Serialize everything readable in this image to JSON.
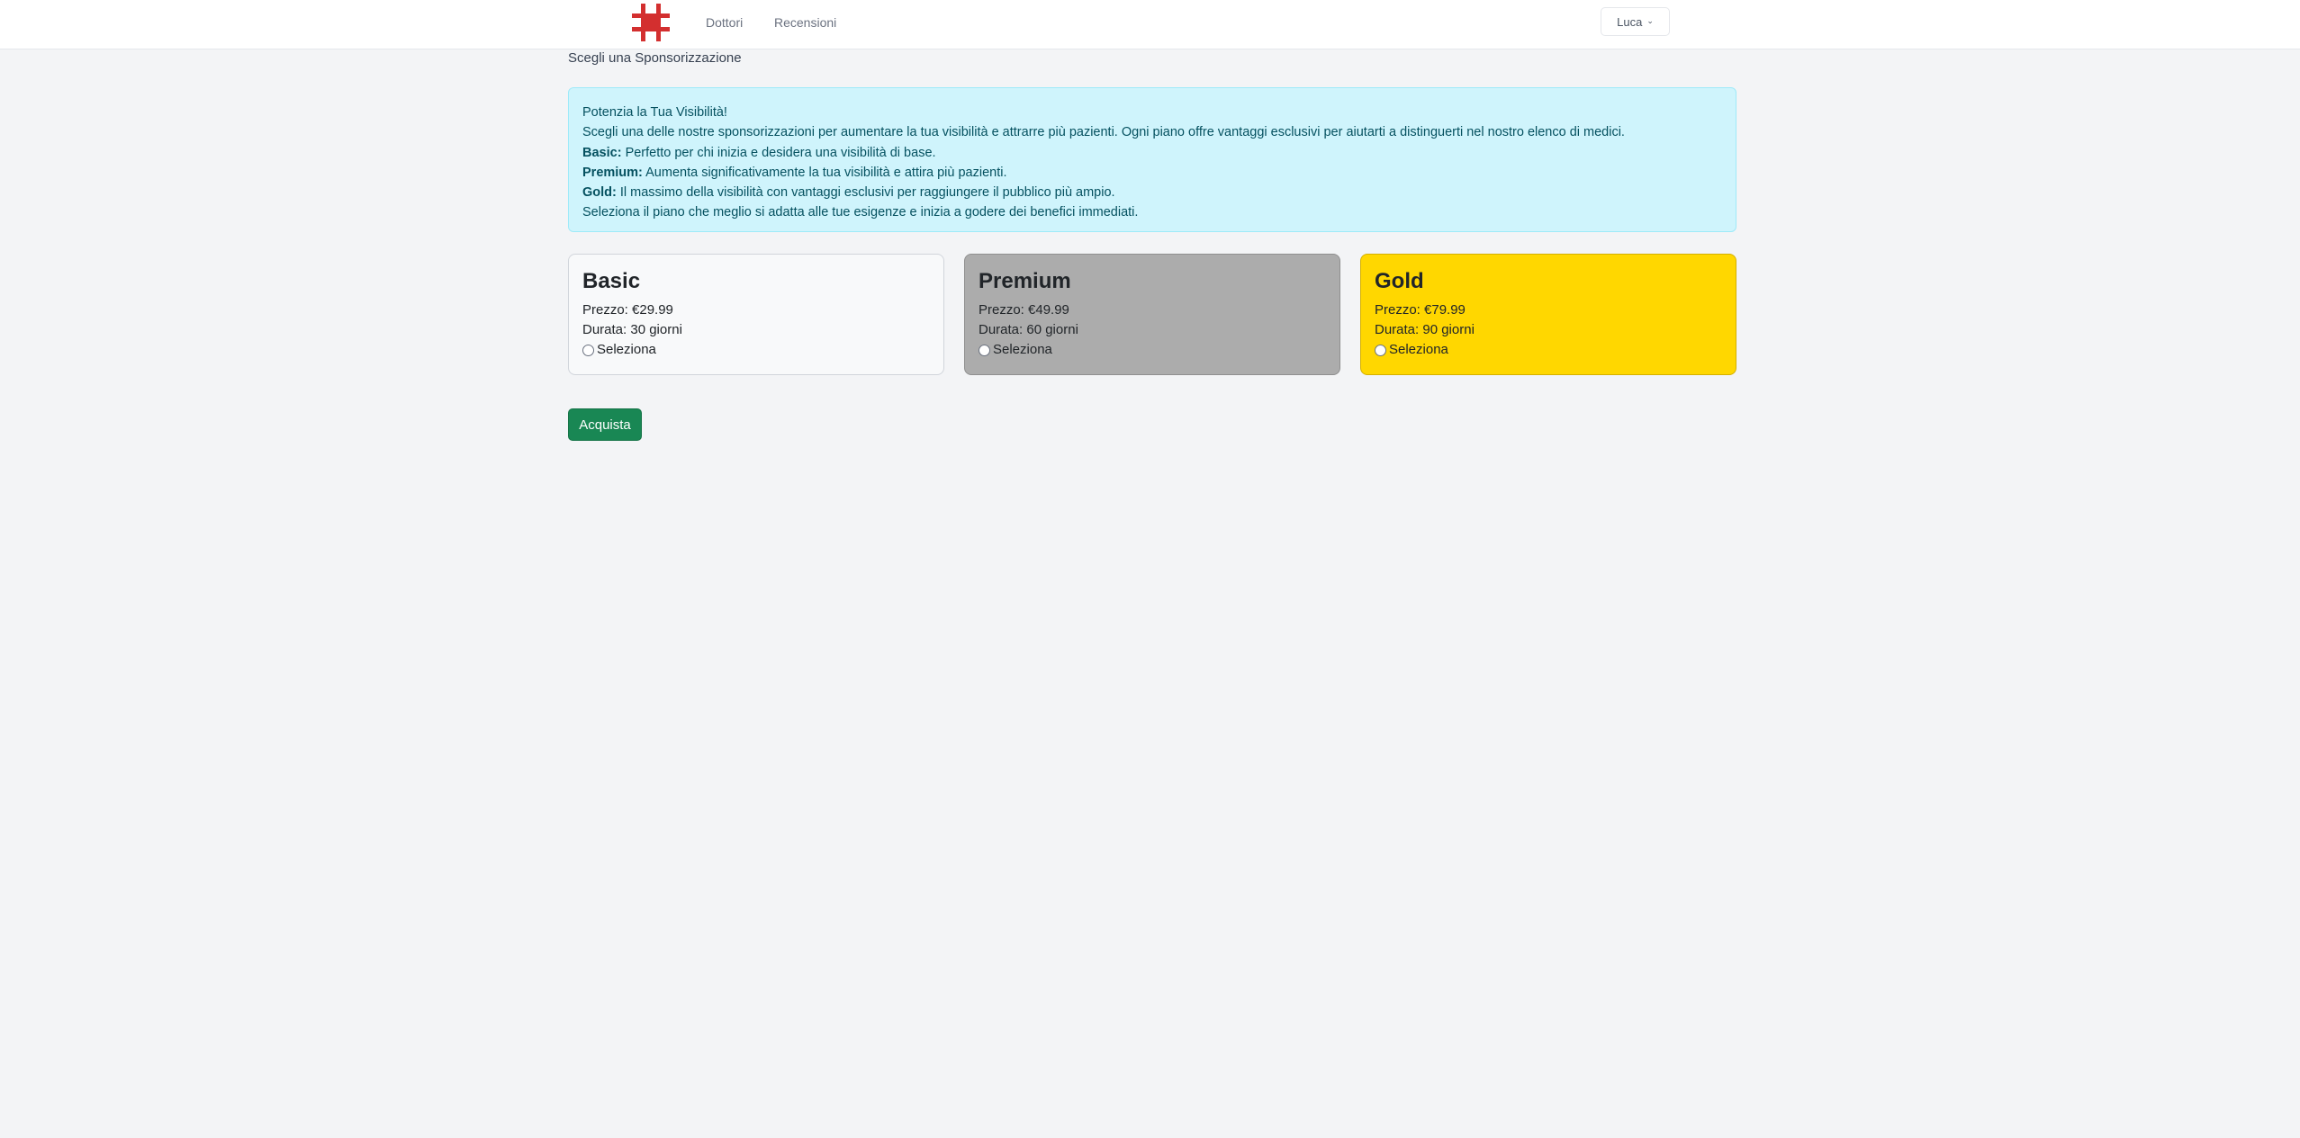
{
  "navbar": {
    "logo_icon": "medical-cross-icon",
    "logo_color": "#d32f2f",
    "links": [
      "Dottori",
      "Recensioni"
    ],
    "user_name": "Luca",
    "user_menu_icon": "chevron-down-icon"
  },
  "page": {
    "title": "Scegli una Sponsorizzazione"
  },
  "alert": {
    "heading": "Potenzia la Tua Visibilità!",
    "intro": "Scegli una delle nostre sponsorizzazioni per aumentare la tua visibilità e attrarre più pazienti. Ogni piano offre vantaggi esclusivi per aiutarti a distinguerti nel nostro elenco di medici.",
    "items": [
      {
        "name": "Basic:",
        "text": "Perfetto per chi inizia e desidera una visibilità di base."
      },
      {
        "name": "Premium:",
        "text": "Aumenta significativamente la tua visibilità e attira più pazienti."
      },
      {
        "name": "Gold:",
        "text": "Il massimo della visibilità con vantaggi esclusivi per raggiungere il pubblico più ampio."
      }
    ],
    "closing": "Seleziona il piano che meglio si adatta alle tue esigenze e inizia a godere dei benefici immediati.",
    "background": "#cff4fc"
  },
  "plans": [
    {
      "name": "Basic",
      "price": "Prezzo: €29.99",
      "duration": "Durata: 30 giorni",
      "select_label": "Seleziona",
      "selected": false,
      "color": "#f8f9fa"
    },
    {
      "name": "Premium",
      "price": "Prezzo: €49.99",
      "duration": "Durata: 60 giorni",
      "select_label": "Seleziona",
      "selected": false,
      "color": "#acacac"
    },
    {
      "name": "Gold",
      "price": "Prezzo: €79.99",
      "duration": "Durata: 90 giorni",
      "select_label": "Seleziona",
      "selected": false,
      "color": "#ffd700"
    }
  ],
  "actions": {
    "buy_label": "Acquista",
    "buy_color": "#198754"
  }
}
